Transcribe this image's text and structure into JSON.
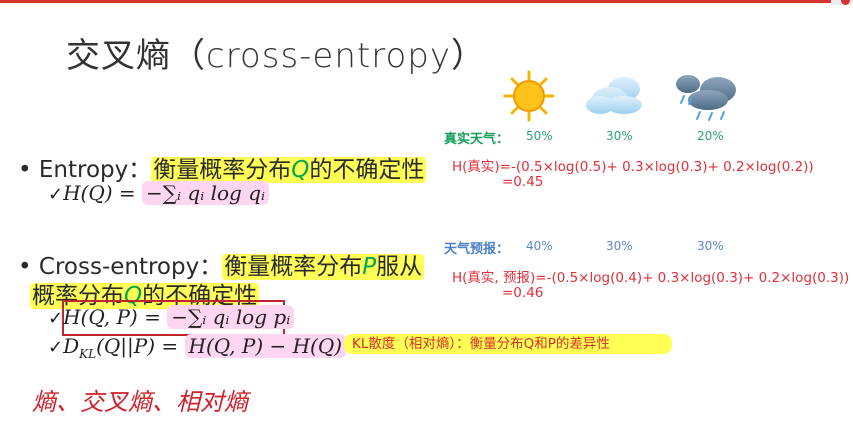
{
  "slide": {
    "title": "交叉熵（cross-entropy）"
  },
  "entropy": {
    "bullet": "•",
    "term": "Entropy：",
    "desc_before": "衡量概率分布",
    "var": "Q",
    "desc_after": "的不确定性",
    "formula": {
      "check": "✓",
      "lhs": "H(Q) = ",
      "rhs": "−∑ᵢ qᵢ log qᵢ"
    }
  },
  "cross_entropy": {
    "bullet": "•",
    "term": "Cross-entropy：",
    "line1_before": "衡量概率分布",
    "var_p": "P",
    "line1_after": "服从",
    "line2_before": "概率分布",
    "var_q": "Q",
    "line2_after": "的不确定性",
    "formula": {
      "check": "✓",
      "lhs": "H(Q, P) = ",
      "rhs": "−∑ᵢ qᵢ log pᵢ"
    },
    "kl": {
      "check": "✓",
      "lhs": "D",
      "sub": "KL",
      "args": "(Q||P) = ",
      "rhs": "H(Q, P) − H(Q)",
      "note": "KL散度（相对熵）：衡量分布Q和P的差异性"
    }
  },
  "weather": {
    "icons": [
      "sun-icon",
      "cloud-icon",
      "rain-cloud-icon"
    ],
    "real_label": "真实天气：",
    "real_probs": [
      "50%",
      "30%",
      "20%"
    ],
    "real_eq_line1": "H(真实)=-(0.5×log(0.5)+ 0.3×log(0.3)+ 0.2×log(0.2))",
    "real_eq_line2": "=0.45",
    "forecast_label": "天气预报：",
    "forecast_probs": [
      "40%",
      "30%",
      "30%"
    ],
    "forecast_eq_line1": "H(真实, 预报)=-(0.5×log(0.4)+ 0.3×log(0.3)+ 0.2×log(0.3))",
    "forecast_eq_line2": "=0.46"
  },
  "handwriting": {
    "text": "熵、交叉熵、相对熵"
  },
  "colors": {
    "accent_red": "#d8342f",
    "highlight_yellow": "#ffff55",
    "highlight_pink": "#ffd6f2",
    "var_green": "#00a651"
  }
}
